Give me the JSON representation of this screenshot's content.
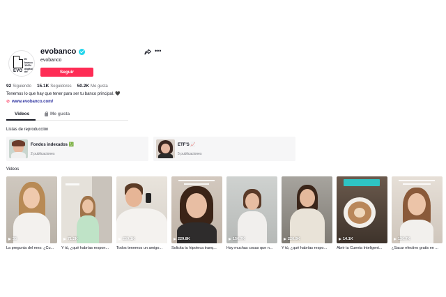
{
  "profile": {
    "username": "evobanco",
    "nickname": "evobanco",
    "follow_label": "Seguir",
    "avatar_text": "EVO",
    "avatar_side_text": "El banco 100% digital de",
    "stats": [
      {
        "value": "92",
        "label": "Siguiendo"
      },
      {
        "value": "15.1K",
        "label": "Seguidores"
      },
      {
        "value": "50.2K",
        "label": "Me gusta"
      }
    ],
    "bio": "Tenemos lo que hay que tener para ser tu banco principal. 🖤",
    "link": "www.evobanco.com/"
  },
  "icons": {
    "verified": "verified-check-icon",
    "share": "share-arrow-icon",
    "more": "more-dots-icon",
    "link": "link-icon",
    "lock": "lock-icon",
    "play": "play-icon"
  },
  "tabs": [
    {
      "label": "Videos",
      "active": true
    },
    {
      "label": "Me gusta",
      "active": false
    }
  ],
  "playlists_title": "Listas de reproducción",
  "playlists": [
    {
      "title": "Fondos indexados 💹",
      "sub": "2 publicaciones"
    },
    {
      "title": "ETF'S 📈",
      "sub": "5 publicaciones"
    }
  ],
  "videos_title": "Videos",
  "videos": [
    {
      "views": "35",
      "caption": "La pregunta del mes: ¿Cu..."
    },
    {
      "views": "71.2K",
      "caption": "Y tú, ¿qué habrías respon..."
    },
    {
      "views": "259.1K",
      "caption": "Todos tenemos un amigo..."
    },
    {
      "views": "229.8K",
      "caption": "Solicita tu hipoteca tranq..."
    },
    {
      "views": "156.7K",
      "caption": "Hay muchas cosas que n..."
    },
    {
      "views": "220.9K",
      "caption": "Y tú, ¿qué habrías respo..."
    },
    {
      "views": "14.1K",
      "caption": "Abrir tu Cuenta Inteligent..."
    },
    {
      "views": "130.7K",
      "caption": "¿Sacar efectivo gratis en ..."
    }
  ],
  "colors": {
    "accent": "#fe2c55",
    "verified": "#20d5ec",
    "link": "#2a2f9e"
  }
}
